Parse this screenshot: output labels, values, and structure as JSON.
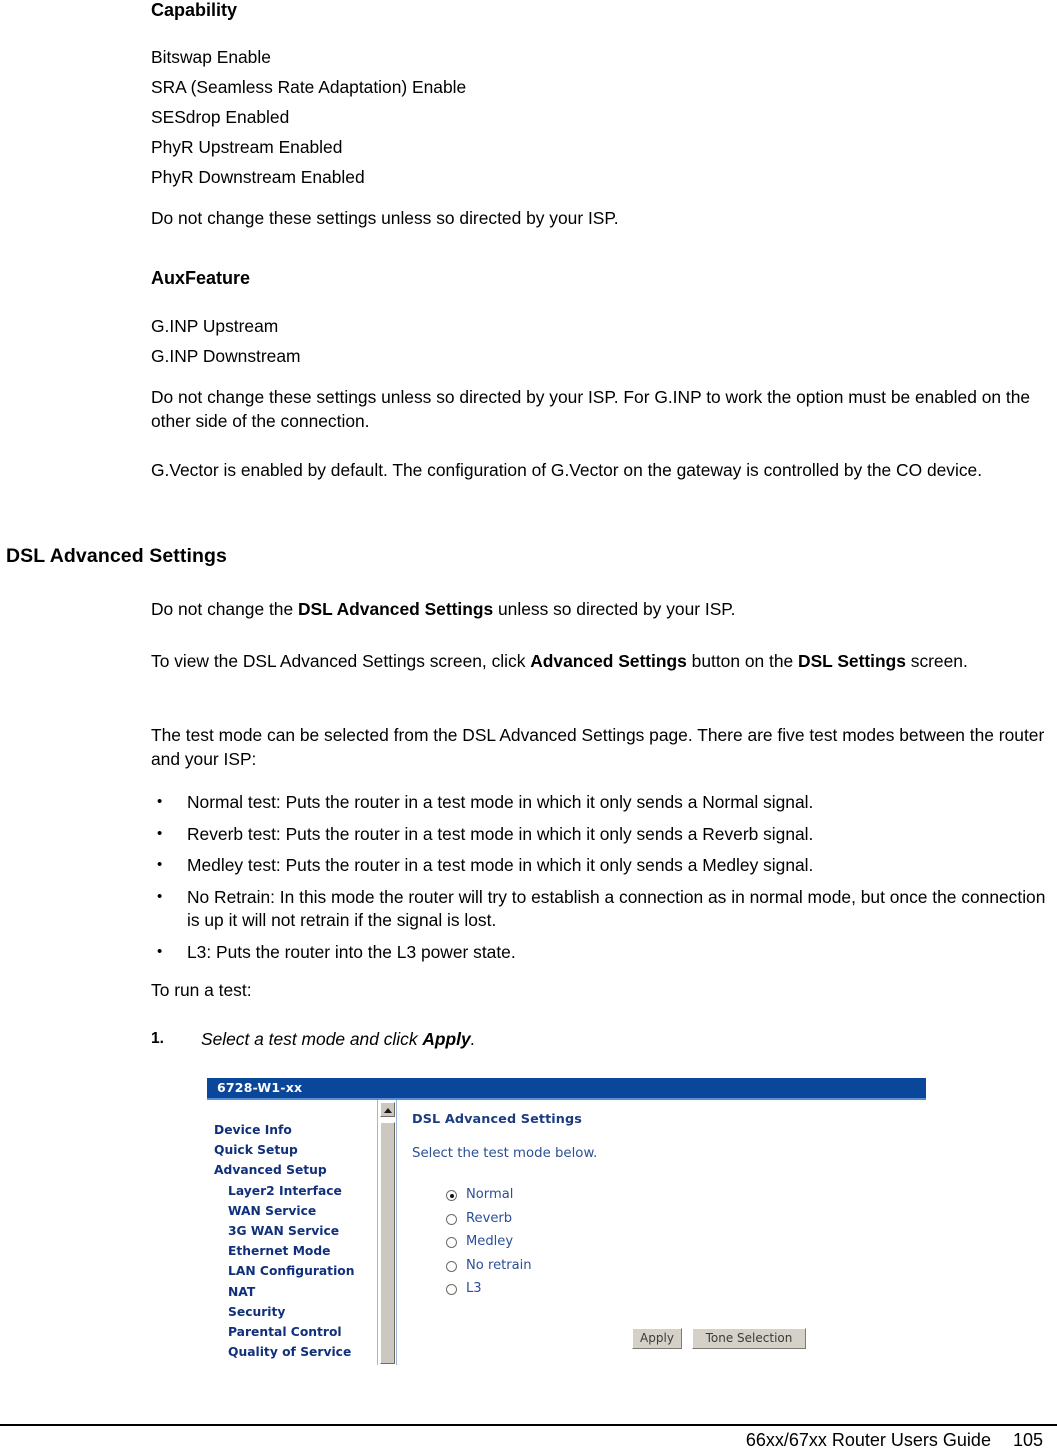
{
  "document": {
    "sections": [
      {
        "heading": "Capability",
        "lines": [
          "Bitswap Enable",
          "SRA (Seamless Rate Adaptation) Enable",
          "SESdrop Enabled",
          "PhyR Upstream Enabled",
          "PhyR Downstream Enabled"
        ],
        "note": "Do not change these settings unless so directed by your ISP."
      },
      {
        "heading": "AuxFeature",
        "lines": [
          "G.INP Upstream",
          "G.INP Downstream"
        ],
        "note": "Do not change these settings unless so directed by your ISP. For G.INP to work the option must be enabled on the other side of the connection.",
        "note2": "G.Vector is enabled by default. The configuration of G.Vector on the gateway is controlled by the CO device."
      }
    ],
    "main_heading": "DSL Advanced Settings",
    "paragraphs": {
      "p1_a": "Do not change the ",
      "p1_b": "DSL Advanced Settings",
      "p1_c": " unless so directed by your ISP.",
      "p2_a": "To view the DSL Advanced Settings screen, click ",
      "p2_b": "Advanced Settings",
      "p2_c": " button on the ",
      "p2_d": "DSL Settings",
      "p2_e": " screen.",
      "p3": "The test mode can be selected from the DSL Advanced Settings page. There are five test modes between the router and your ISP:"
    },
    "bullets": [
      "Normal test: Puts the router in a test mode in which it only sends a Normal signal.",
      "Reverb test: Puts the router in a test mode in which it only sends a Reverb signal.",
      "Medley test: Puts the router in a test mode in which it only sends a Medley signal.",
      "No Retrain: In this mode the router will try to establish a connection as in normal mode, but once the connection is up it will not retrain if the signal is lost.",
      "L3: Puts the router into the L3 power state."
    ],
    "run_test_lead": "To run a test:",
    "step": {
      "number": "1.",
      "text_a": "Select a test mode and click ",
      "text_b": "Apply",
      "text_c": "."
    }
  },
  "screenshot": {
    "title": "6728-W1-xx",
    "title_bar_color": "#0a4699",
    "nav_items": [
      {
        "label": "Device Info",
        "level": 1
      },
      {
        "label": "Quick Setup",
        "level": 1
      },
      {
        "label": "Advanced Setup",
        "level": 1
      },
      {
        "label": "Layer2 Interface",
        "level": 2
      },
      {
        "label": "WAN Service",
        "level": 2
      },
      {
        "label": "3G WAN Service",
        "level": 2
      },
      {
        "label": "Ethernet Mode",
        "level": 2
      },
      {
        "label": "LAN Configuration",
        "level": 2
      },
      {
        "label": "NAT",
        "level": 2
      },
      {
        "label": "Security",
        "level": 2
      },
      {
        "label": "Parental Control",
        "level": 2
      },
      {
        "label": "Quality of Service",
        "level": 2
      }
    ],
    "panel_heading": "DSL Advanced Settings",
    "panel_sub": "Select the test mode below.",
    "nav_link_color": "#11307c",
    "radio_options": [
      {
        "label": "Normal",
        "selected": true
      },
      {
        "label": "Reverb",
        "selected": false
      },
      {
        "label": "Medley",
        "selected": false
      },
      {
        "label": "No retrain",
        "selected": false
      },
      {
        "label": "L3",
        "selected": false
      }
    ],
    "buttons": {
      "apply": "Apply",
      "tone_selection": "Tone Selection"
    }
  },
  "footer": {
    "title": "66xx/67xx Router Users Guide",
    "page_number": "105"
  }
}
